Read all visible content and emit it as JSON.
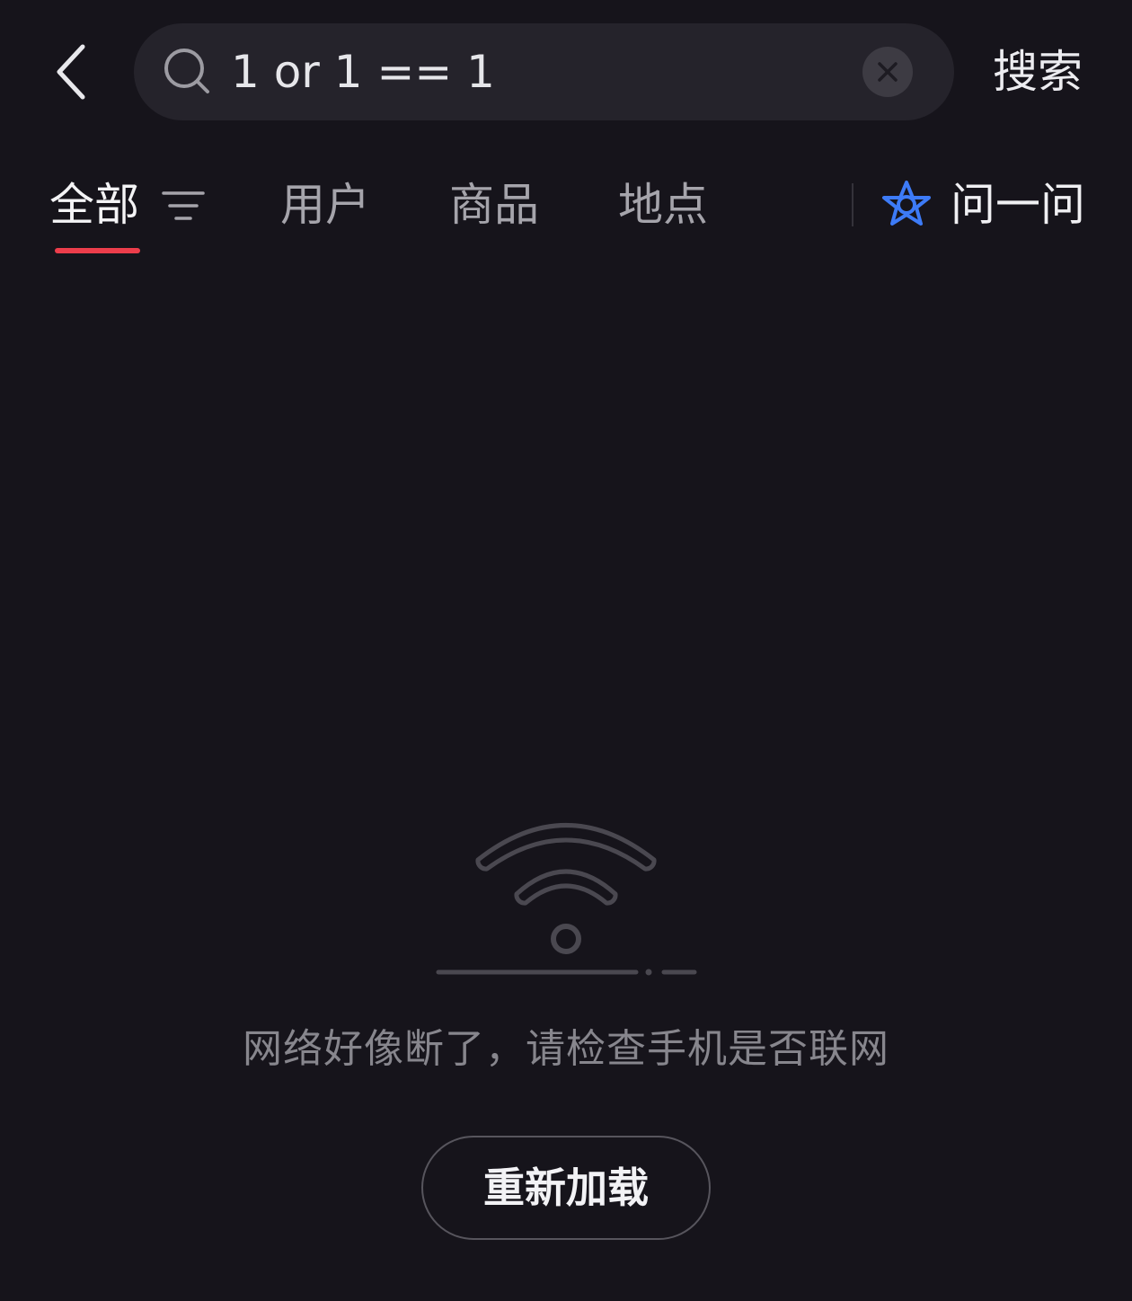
{
  "header": {
    "search_value": "1 or 1 == 1",
    "search_button_label": "搜索"
  },
  "tabs": [
    {
      "label": "全部",
      "active": true
    },
    {
      "label": "用户",
      "active": false
    },
    {
      "label": "商品",
      "active": false
    },
    {
      "label": "地点",
      "active": false
    }
  ],
  "ask": {
    "label": "问一问",
    "icon_color": "#3d7bf7"
  },
  "empty_state": {
    "icon": "wifi-disconnected-icon",
    "message": "网络好像断了，请检查手机是否联网",
    "reload_label": "重新加载"
  },
  "colors": {
    "background": "#16141b",
    "accent": "#ec3d4b",
    "ask_icon": "#3d7bf7"
  }
}
